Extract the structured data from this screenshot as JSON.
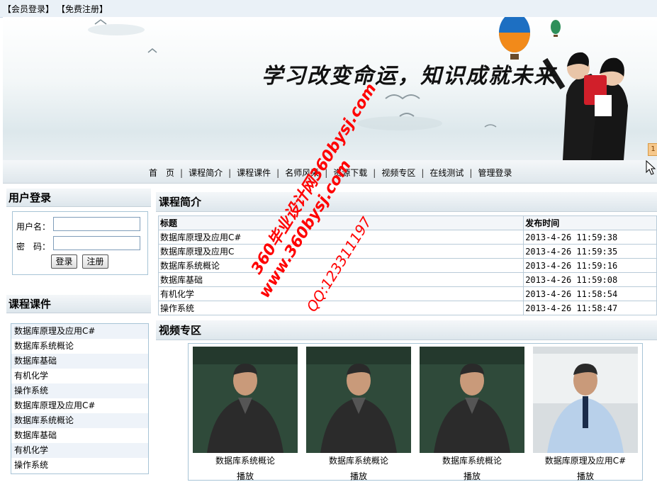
{
  "topbar": {
    "login": "【会员登录】",
    "register": "【免费注册】"
  },
  "banner": {
    "slogan": "学习改变命运，知识成就未来",
    "slide_number": "1"
  },
  "nav": [
    "首　页",
    "课程简介",
    "课程课件",
    "名师风采",
    "资源下载",
    "视频专区",
    "在线测试",
    "管理登录"
  ],
  "login": {
    "title": "用户登录",
    "username_label": "用户名：",
    "password_label": "密　码：",
    "login_btn": "登录",
    "register_btn": "注册"
  },
  "course_section": {
    "title": "课程课件",
    "items": [
      "数据库原理及应用C#",
      "数据库系统概论",
      "数据库基础",
      "有机化学",
      "操作系统",
      "数据库原理及应用C#",
      "数据库系统概论",
      "数据库基础",
      "有机化学",
      "操作系统"
    ]
  },
  "intro": {
    "title": "课程简介",
    "col_title": "标题",
    "col_time": "发布时间",
    "rows": [
      {
        "title": "数据库原理及应用C#",
        "time": "2013-4-26 11:59:38"
      },
      {
        "title": "数据库原理及应用C",
        "time": "2013-4-26 11:59:35"
      },
      {
        "title": "数据库系统概论",
        "time": "2013-4-26 11:59:16"
      },
      {
        "title": "数据库基础",
        "time": "2013-4-26 11:59:08"
      },
      {
        "title": "有机化学",
        "time": "2013-4-26 11:58:54"
      },
      {
        "title": "操作系统",
        "time": "2013-4-26 11:58:47"
      }
    ]
  },
  "video": {
    "title": "视频专区",
    "items": [
      {
        "caption": "数据库系统概论",
        "play": "播放"
      },
      {
        "caption": "数据库系统概论",
        "play": "播放"
      },
      {
        "caption": "数据库系统概论",
        "play": "播放"
      },
      {
        "caption": "数据库原理及应用C#",
        "play": "播放"
      }
    ]
  },
  "watermark": {
    "line1": "360毕业设计网",
    "line1b": "360bysj.com",
    "line2": "www.360bysj.com",
    "line3": "QQ:123311197"
  }
}
